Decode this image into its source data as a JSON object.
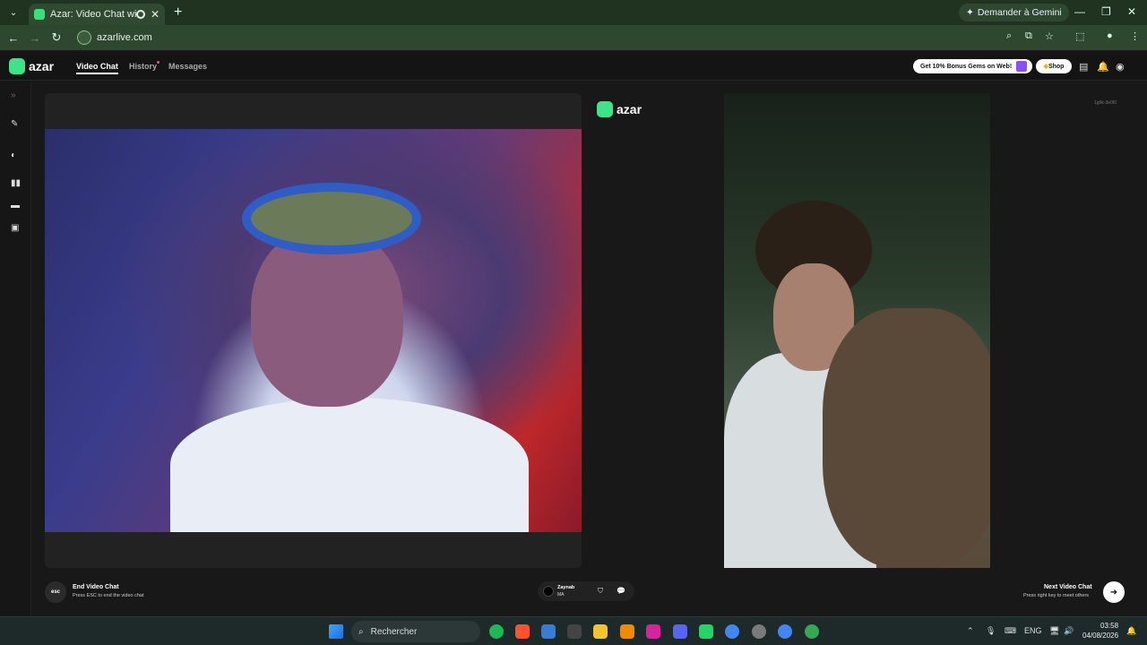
{
  "browser": {
    "tab_title": "Azar: Video Chat with New",
    "tab_close": "✕",
    "new_tab": "+",
    "gemini_label": "Demander à Gemini",
    "url": "azarlive.com"
  },
  "app": {
    "logo_text": "azar",
    "nav": {
      "video_chat": "Video Chat",
      "history": "History",
      "messages": "Messages"
    },
    "promo": "Get 10% Bonus Gems on Web!",
    "shop": "Shop"
  },
  "stage": {
    "logo_text": "azar",
    "session_id": "1g9k-3e0I0"
  },
  "controls": {
    "esc_label": "esc",
    "end_title": "End Video Chat",
    "end_sub": "Press ESC to end the video chat",
    "peer_name": "Zaynab",
    "peer_country": "MA",
    "next_title": "Next Video Chat",
    "next_sub": "Press right key to meet others"
  },
  "taskbar": {
    "search_placeholder": "Rechercher",
    "lang": "ENG",
    "time": "03:58",
    "date": "04/08/2026"
  },
  "colors": {
    "brand": "#3ee38a",
    "browser_frame": "#2e472f",
    "app_bg": "#181818"
  }
}
